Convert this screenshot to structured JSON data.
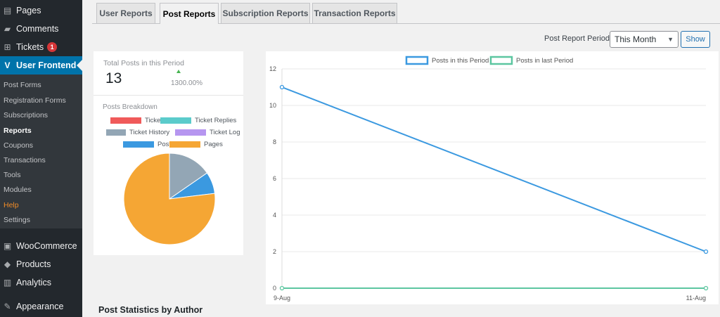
{
  "sidebar": {
    "top_items": [
      {
        "label": "Pages",
        "icon": "pages-icon"
      },
      {
        "label": "Comments",
        "icon": "comments-icon"
      },
      {
        "label": "Tickets",
        "icon": "tickets-icon",
        "badge": "1"
      },
      {
        "label": "User Frontend",
        "icon": "user-frontend-icon"
      }
    ],
    "submenu": [
      "Post Forms",
      "Registration Forms",
      "Subscriptions",
      "Reports",
      "Coupons",
      "Transactions",
      "Tools",
      "Modules",
      "Help",
      "Settings"
    ],
    "bottom_items": [
      {
        "label": "WooCommerce",
        "icon": "woocommerce-icon"
      },
      {
        "label": "Products",
        "icon": "products-icon"
      },
      {
        "label": "Analytics",
        "icon": "analytics-icon"
      },
      {
        "label": "Appearance",
        "icon": "appearance-icon"
      }
    ]
  },
  "tabs": [
    "User Reports",
    "Post Reports",
    "Subscription Reports",
    "Transaction Reports"
  ],
  "active_tab": "Post Reports",
  "period": {
    "label": "Post Report Period:",
    "selected": "This Month",
    "button": "Show"
  },
  "summary": {
    "total_label": "Total Posts in this Period",
    "total_value": "13",
    "change": "1300.00%"
  },
  "breakdown": {
    "title": "Posts Breakdown",
    "legend": [
      {
        "name": "Tickets",
        "color": "#f05a5a"
      },
      {
        "name": "Ticket Replies",
        "color": "#5bcbcb"
      },
      {
        "name": "Ticket History",
        "color": "#93a6b5"
      },
      {
        "name": "Ticket Log",
        "color": "#b696f0"
      },
      {
        "name": "Posts",
        "color": "#3b99e0"
      },
      {
        "name": "Pages",
        "color": "#f5a634"
      }
    ]
  },
  "author_stats_title": "Post Statistics by Author",
  "chart_data": [
    {
      "type": "pie",
      "title": "Posts Breakdown",
      "labels": [
        "Tickets",
        "Ticket Replies",
        "Ticket History",
        "Ticket Log",
        "Posts",
        "Pages"
      ],
      "values": [
        0,
        0,
        2,
        0,
        1,
        10
      ],
      "colors": [
        "#f05a5a",
        "#5bcbcb",
        "#93a6b5",
        "#b696f0",
        "#3b99e0",
        "#f5a634"
      ]
    },
    {
      "type": "line",
      "x": [
        "9-Aug",
        "11-Aug"
      ],
      "series": [
        {
          "name": "Posts in this Period",
          "values": [
            11,
            2
          ],
          "color": "#3b99e0"
        },
        {
          "name": "Posts in last Period",
          "values": [
            0,
            0
          ],
          "color": "#5cc6a0"
        }
      ],
      "ylim": [
        0,
        12
      ],
      "yticks": [
        0,
        2,
        4,
        6,
        8,
        10,
        12
      ],
      "grid": true,
      "legend": "top"
    }
  ]
}
